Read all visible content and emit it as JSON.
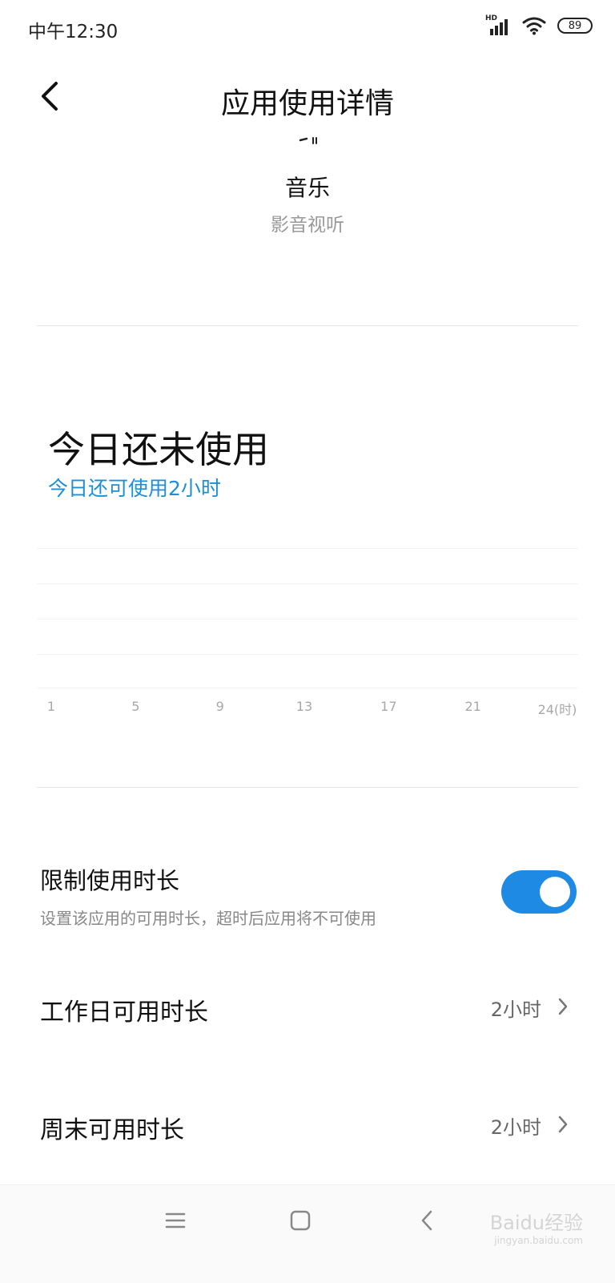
{
  "status_bar": {
    "time": "中午12:30",
    "network_label": "HD",
    "battery_level": "89",
    "icons": [
      "signal-icon",
      "wifi-icon",
      "battery-icon"
    ]
  },
  "header": {
    "title": "应用使用详情",
    "back_icon": "chevron-left-icon"
  },
  "app": {
    "name": "音乐",
    "category": "影音视听"
  },
  "usage": {
    "title": "今日还未使用",
    "subtitle": "今日还可使用2小时",
    "accent_color": "#1c8fd6"
  },
  "chart_data": {
    "type": "bar",
    "categories": [
      "1",
      "5",
      "9",
      "13",
      "17",
      "21",
      "24(时)"
    ],
    "values": [
      0,
      0,
      0,
      0,
      0,
      0,
      0
    ],
    "xlabel": "",
    "ylabel": "",
    "grid": true
  },
  "limit": {
    "title": "限制使用时长",
    "description": "设置该应用的可用时长，超时后应用将不可使用",
    "enabled": true,
    "toggle_color": "#1f8ae4"
  },
  "weekday": {
    "label": "工作日可用时长",
    "value": "2小时"
  },
  "weekend": {
    "label": "周末可用时长",
    "value": "2小时"
  },
  "nav": {
    "items": [
      "menu-icon",
      "home-icon",
      "back-icon"
    ]
  },
  "watermark": {
    "text": "Baidu经验",
    "url": "jingyan.baidu.com"
  }
}
